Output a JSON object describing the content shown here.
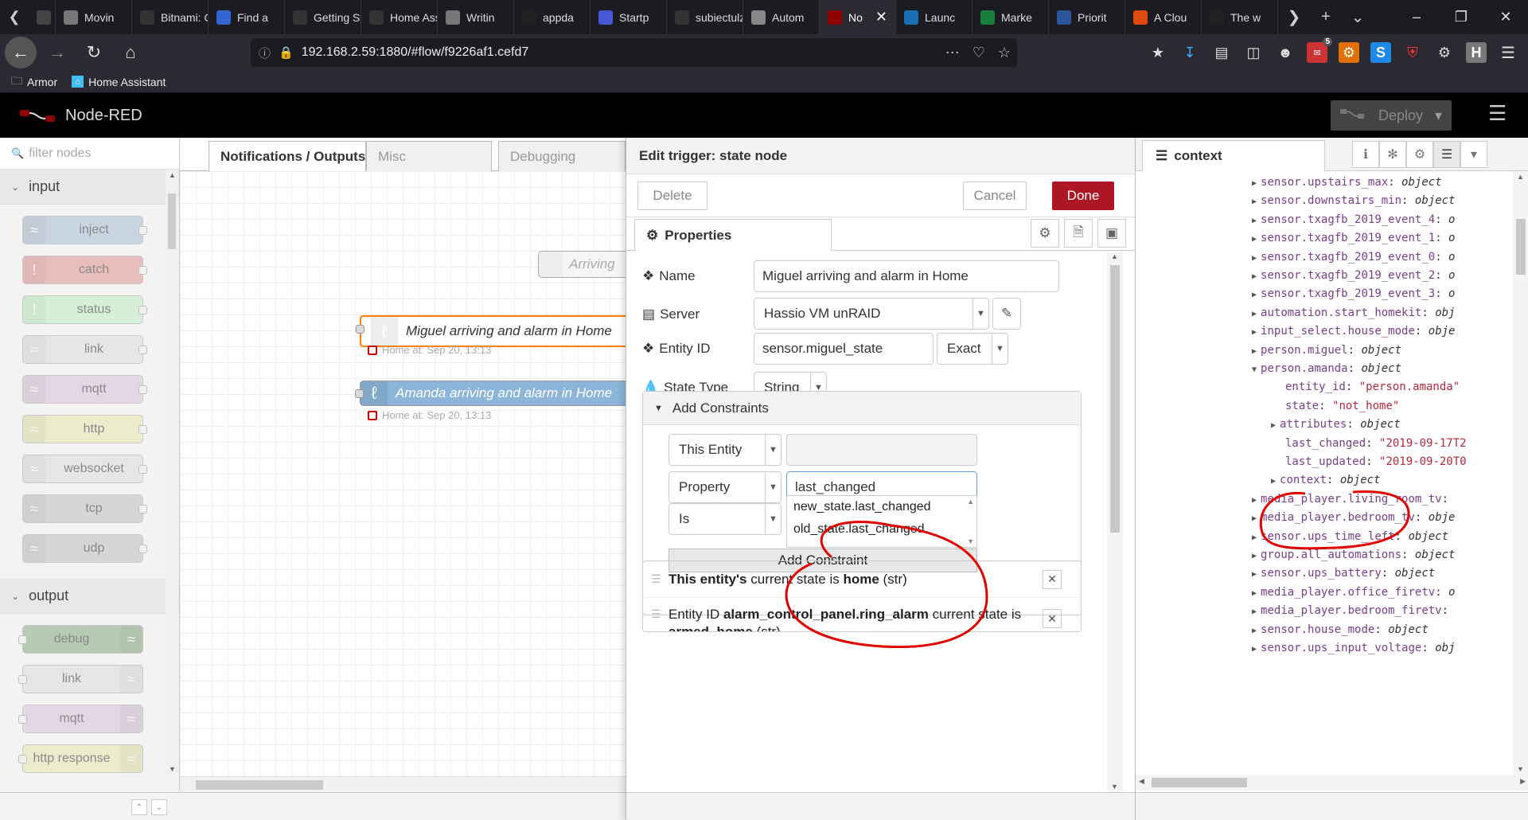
{
  "browser": {
    "tabs": [
      {
        "label": "",
        "color": "#444"
      },
      {
        "label": "Movin",
        "color": "#777"
      },
      {
        "label": "Bitnami: O",
        "color": "#333"
      },
      {
        "label": "Find a",
        "color": "#3465d1"
      },
      {
        "label": "Getting St",
        "color": "#333"
      },
      {
        "label": "Home Ass",
        "color": "#333"
      },
      {
        "label": "Writin",
        "color": "#777"
      },
      {
        "label": "appda",
        "color": "#222"
      },
      {
        "label": "Startp",
        "color": "#4658d6"
      },
      {
        "label": "subiectulz",
        "color": "#333"
      },
      {
        "label": "Autom",
        "color": "#888"
      },
      {
        "label": "No",
        "color": "#8f0000"
      },
      {
        "label": "Launc",
        "color": "#1b6fb5"
      },
      {
        "label": "Marke",
        "color": "#1a7f3c"
      },
      {
        "label": "Priorit",
        "color": "#2b579a"
      },
      {
        "label": "A Clou",
        "color": "#e04a0d"
      },
      {
        "label": "The w",
        "color": "#222"
      }
    ],
    "url": "192.168.2.59:1880/#flow/f9226af1.cefd7",
    "bookmarks": [
      {
        "label": "Armor",
        "icon": "folder-icon"
      },
      {
        "label": "Home Assistant",
        "icon": "home-assistant-icon"
      }
    ],
    "notification_badge": "5"
  },
  "nodered": {
    "title": "Node-RED",
    "deploy_label": "Deploy"
  },
  "palette": {
    "filter_placeholder": "filter nodes",
    "categories": [
      {
        "name": "input",
        "nodes": [
          {
            "label": "inject",
            "color": "#a6bbcf"
          },
          {
            "label": "catch",
            "color": "#e49191"
          },
          {
            "label": "status",
            "color": "#c0edc0"
          },
          {
            "label": "link",
            "color": "#dddddd"
          },
          {
            "label": "mqtt",
            "color": "#d8bfd8"
          },
          {
            "label": "http",
            "color": "#e7e7ae"
          },
          {
            "label": "websocket",
            "color": "#dddddd"
          },
          {
            "label": "tcp",
            "color": "#c0c0c0"
          },
          {
            "label": "udp",
            "color": "#c0c0c0"
          }
        ]
      },
      {
        "name": "output",
        "nodes": [
          {
            "label": "debug",
            "color": "#87a980"
          },
          {
            "label": "link",
            "color": "#dddddd"
          },
          {
            "label": "mqtt",
            "color": "#d8bfd8"
          },
          {
            "label": "http response",
            "color": "#e7e7ae"
          }
        ]
      }
    ]
  },
  "workspace": {
    "tabs": [
      "Notifications / Outputs",
      "Misc",
      "Debugging"
    ],
    "ghost_node_label": "Arriving",
    "nodes": [
      {
        "label": "Miguel arriving and alarm in Home",
        "status": "Home at: Sep 20, 13:13"
      },
      {
        "label": "Amanda arriving and alarm in Home",
        "status": "Home at: Sep 20, 13:13"
      }
    ]
  },
  "tray": {
    "title": "Edit trigger: state node",
    "delete_label": "Delete",
    "cancel_label": "Cancel",
    "done_label": "Done",
    "properties_tab": "Properties",
    "fields": {
      "name_label": "Name",
      "name_value": "Miguel arriving and alarm in Home",
      "server_label": "Server",
      "server_value": "Hassio VM unRAID",
      "entity_label": "Entity ID",
      "entity_value": "sensor.miguel_state",
      "entity_match": "Exact",
      "statetype_label": "State Type",
      "statetype_value": "String"
    },
    "constraints": {
      "header": "Add Constraints",
      "target_select": "This Entity",
      "target_input": "",
      "property_select": "Property",
      "property_input": "last_changed",
      "comparator_select": "Is",
      "autocomplete": [
        "new_state.last_changed",
        "old_state.last_changed"
      ],
      "add_button": "Add Constraint"
    },
    "constraint_list": [
      {
        "prefix": "",
        "bold1": "This entity's",
        "mid": " current state is ",
        "bold2": "home",
        "suffix": " (str)"
      },
      {
        "prefix": "Entity ID ",
        "bold1": "alarm_control_panel.ring_alarm",
        "mid": " current state is",
        "bold2": "armed_home",
        "suffix": " (str)"
      }
    ]
  },
  "sidebar": {
    "tab_label": "context",
    "entries": [
      {
        "key": "sensor.upstairs_max",
        "val": "object",
        "kind": "type",
        "arrow": "right",
        "indent": 0
      },
      {
        "key": "sensor.downstairs_min",
        "val": "object",
        "kind": "type",
        "arrow": "right",
        "indent": 0
      },
      {
        "key": "sensor.txagfb_2019_event_4",
        "val": "o",
        "kind": "type",
        "arrow": "right",
        "indent": 0
      },
      {
        "key": "sensor.txagfb_2019_event_1",
        "val": "o",
        "kind": "type",
        "arrow": "right",
        "indent": 0
      },
      {
        "key": "sensor.txagfb_2019_event_0",
        "val": "o",
        "kind": "type",
        "arrow": "right",
        "indent": 0
      },
      {
        "key": "sensor.txagfb_2019_event_2",
        "val": "o",
        "kind": "type",
        "arrow": "right",
        "indent": 0
      },
      {
        "key": "sensor.txagfb_2019_event_3",
        "val": "o",
        "kind": "type",
        "arrow": "right",
        "indent": 0
      },
      {
        "key": "automation.start_homekit",
        "val": "obj",
        "kind": "type",
        "arrow": "right",
        "indent": 0
      },
      {
        "key": "input_select.house_mode",
        "val": "obje",
        "kind": "type",
        "arrow": "right",
        "indent": 0
      },
      {
        "key": "person.miguel",
        "val": "object",
        "kind": "type",
        "arrow": "right",
        "indent": 0
      },
      {
        "key": "person.amanda",
        "val": "object",
        "kind": "type",
        "arrow": "down",
        "indent": 0
      },
      {
        "key": "entity_id",
        "val": "\"person.amanda\"",
        "kind": "str",
        "arrow": "",
        "indent": 1
      },
      {
        "key": "state",
        "val": "\"not_home\"",
        "kind": "str",
        "arrow": "",
        "indent": 1
      },
      {
        "key": "attributes",
        "val": "object",
        "kind": "type",
        "arrow": "right",
        "indent": 1
      },
      {
        "key": "last_changed",
        "val": "\"2019-09-17T2",
        "kind": "str",
        "arrow": "",
        "indent": 1
      },
      {
        "key": "last_updated",
        "val": "\"2019-09-20T0",
        "kind": "str",
        "arrow": "",
        "indent": 1
      },
      {
        "key": "context",
        "val": "object",
        "kind": "type",
        "arrow": "right",
        "indent": 1
      },
      {
        "key": "media_player.living_room_tv",
        "val": "",
        "kind": "type",
        "arrow": "right",
        "indent": 0
      },
      {
        "key": "media_player.bedroom_tv",
        "val": "obje",
        "kind": "type",
        "arrow": "right",
        "indent": 0
      },
      {
        "key": "sensor.ups_time_left",
        "val": "object",
        "kind": "type",
        "arrow": "right",
        "indent": 0
      },
      {
        "key": "group.all_automations",
        "val": "object",
        "kind": "type",
        "arrow": "right",
        "indent": 0
      },
      {
        "key": "sensor.ups_battery",
        "val": "object",
        "kind": "type",
        "arrow": "right",
        "indent": 0
      },
      {
        "key": "media_player.office_firetv",
        "val": "o",
        "kind": "type",
        "arrow": "right",
        "indent": 0
      },
      {
        "key": "media_player.bedroom_firetv",
        "val": "",
        "kind": "type",
        "arrow": "right",
        "indent": 0
      },
      {
        "key": "sensor.house_mode",
        "val": "object",
        "kind": "type",
        "arrow": "right",
        "indent": 0
      },
      {
        "key": "sensor.ups_input_voltage",
        "val": "obj",
        "kind": "type",
        "arrow": "right",
        "indent": 0
      }
    ]
  },
  "colors": {
    "node_red_accent": "#ad1625",
    "flow_node": "#8cb5d9",
    "annotation": "#e00000"
  }
}
